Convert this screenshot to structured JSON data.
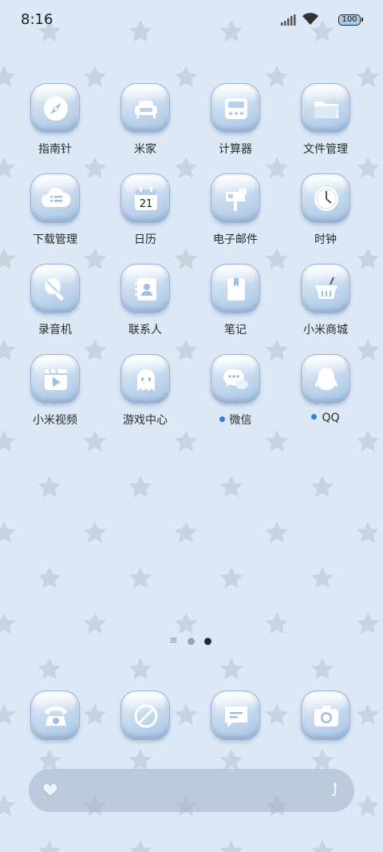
{
  "status_bar": {
    "time": "8:16",
    "battery": "100"
  },
  "apps": [
    {
      "label": "指南针",
      "icon": "compass-icon"
    },
    {
      "label": "米家",
      "icon": "sofa-icon"
    },
    {
      "label": "计算器",
      "icon": "calculator-icon"
    },
    {
      "label": "文件管理",
      "icon": "folder-icon"
    },
    {
      "label": "下载管理",
      "icon": "cloud-list-icon"
    },
    {
      "label": "日历",
      "icon": "calendar-icon",
      "badge_text": "21"
    },
    {
      "label": "电子邮件",
      "icon": "mailbox-icon"
    },
    {
      "label": "时钟",
      "icon": "clock-icon"
    },
    {
      "label": "录音机",
      "icon": "microphone-icon"
    },
    {
      "label": "联系人",
      "icon": "contacts-icon"
    },
    {
      "label": "笔记",
      "icon": "notebook-icon"
    },
    {
      "label": "小米商城",
      "icon": "basket-icon"
    },
    {
      "label": "小米视频",
      "icon": "video-player-icon"
    },
    {
      "label": "游戏中心",
      "icon": "ghost-icon"
    },
    {
      "label": "微信",
      "icon": "wechat-icon",
      "new_dot": true
    },
    {
      "label": "QQ",
      "icon": "qq-penguin-icon",
      "new_dot": true
    }
  ],
  "page_indicator": {
    "lines_glyph": "≡",
    "pages": 2,
    "active_page": 2
  },
  "dock": [
    {
      "icon": "phone-icon"
    },
    {
      "icon": "browser-icon"
    },
    {
      "icon": "message-icon"
    },
    {
      "icon": "camera-icon"
    }
  ],
  "colors": {
    "background": "#dce8f6",
    "star": "#c7d1de",
    "icon_glyph": "#ffffff",
    "notification_dot": "#2f7fe0"
  }
}
